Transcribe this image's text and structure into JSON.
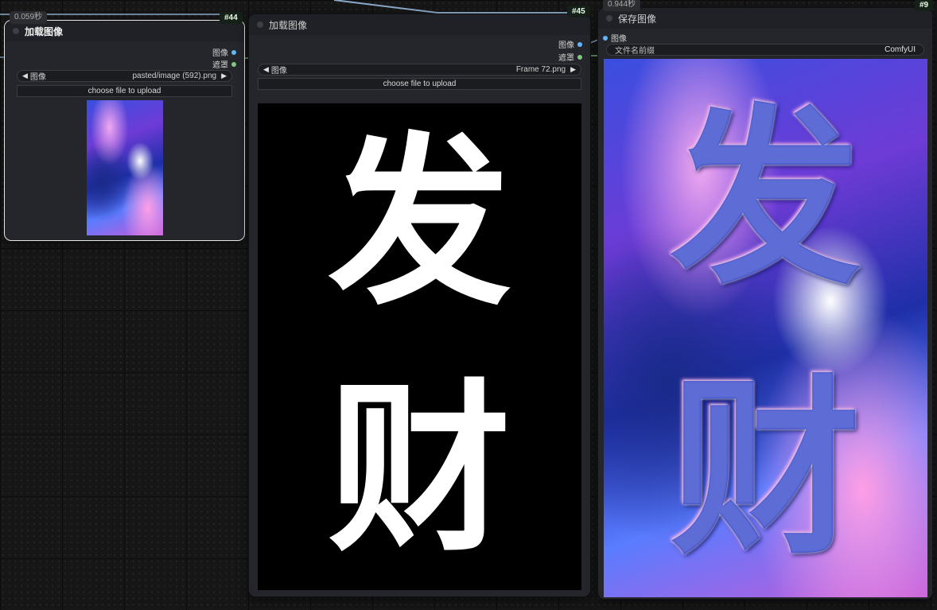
{
  "node44": {
    "timer": "0.059秒",
    "badge": "#44",
    "title": "加载图像",
    "outputs": {
      "image": "图像",
      "mask": "遮罩"
    },
    "image_widget": {
      "label": "图像",
      "value": "pasted/image (592).png"
    },
    "upload_label": "choose file to upload"
  },
  "node45": {
    "badge": "#45",
    "title": "加载图像",
    "outputs": {
      "image": "图像",
      "mask": "遮罩"
    },
    "image_widget": {
      "label": "图像",
      "value": "Frame 72.png"
    },
    "upload_label": "choose file to upload",
    "preview_chars": [
      "发",
      "财"
    ]
  },
  "node9": {
    "timer": "0.944秒",
    "badge": "#9",
    "title": "保存图像",
    "input": {
      "image": "图像"
    },
    "filename_prefix": {
      "label": "文件名前缀",
      "value": "ComfyUI"
    },
    "preview_chars": [
      "发",
      "财"
    ]
  },
  "colors": {
    "canvas_bg": "#161616",
    "node_bg": "#24262b",
    "image_port": "#64b5f6",
    "mask_port": "#81c784",
    "wire": "#8aa9c8"
  }
}
